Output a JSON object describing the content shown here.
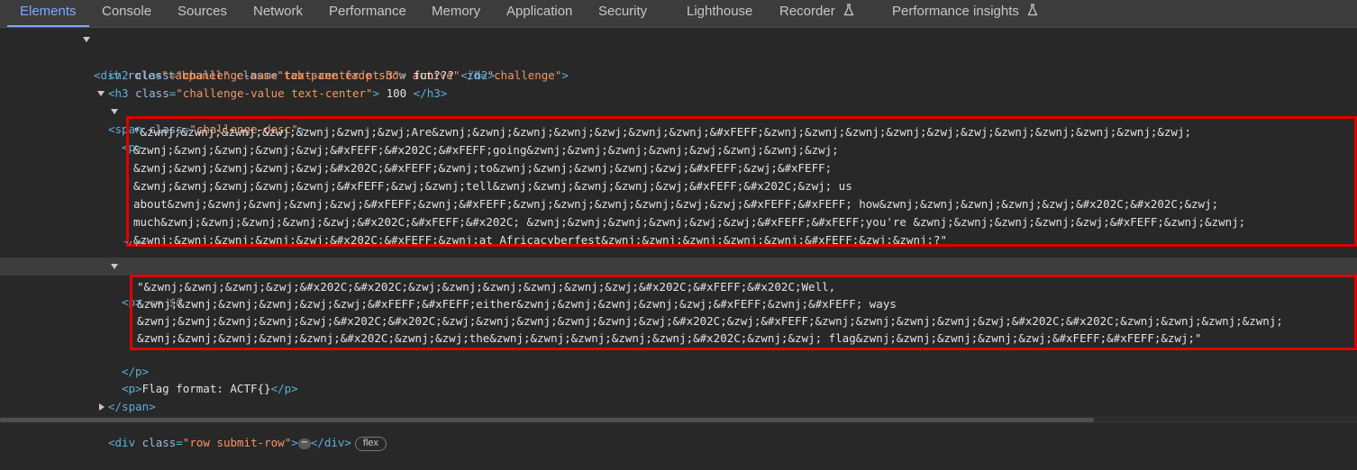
{
  "tabs": [
    {
      "label": "Elements"
    },
    {
      "label": "Console"
    },
    {
      "label": "Sources"
    },
    {
      "label": "Network"
    },
    {
      "label": "Performance"
    },
    {
      "label": "Memory"
    },
    {
      "label": "Application"
    },
    {
      "label": "Security"
    },
    {
      "label": "Lighthouse"
    },
    {
      "label": "Recorder"
    },
    {
      "label": "Performance insights"
    }
  ],
  "tree": {
    "div_open_tag": "div",
    "div_role_name": "role",
    "div_role_val": "\"tabpanel\"",
    "div_class_name": "class",
    "div_class_val": "\"tab-pane fade show active\"",
    "div_id_name": "id",
    "div_id_val": "\"challenge\"",
    "h2_class_val": "\"challenge-name text-center pt-3\"",
    "h2_text": " fun??? ",
    "h3_class_val": "\"challenge-value text-center\"",
    "h3_text": " 100 ",
    "span_class_val": "\"challenge-desc\"",
    "p1_lines": [
      "\"&zwnj;&zwnj;&zwnj;&zwj;&zwnj;&zwnj;&zwj;Are&zwnj;&zwnj;&zwnj;&zwnj;&zwj;&zwnj;&zwnj;&#xFEFF;&zwnj;&zwnj;&zwnj;&zwnj;&zwj;&zwj;&zwnj;&zwnj;&zwnj;&zwnj;&zwj;",
      "&zwnj;&zwnj;&zwnj;&zwnj;&zwj;&#xFEFF;&#x202C;&#xFEFF;going&zwnj;&zwnj;&zwnj;&zwnj;&zwj;&zwnj;&zwnj;&zwj;",
      "&zwnj;&zwnj;&zwnj;&zwnj;&zwj;&#x202C;&#xFEFF;&zwnj;to&zwnj;&zwnj;&zwnj;&zwnj;&zwj;&#xFEFF;&zwj;&#xFEFF;",
      "&zwnj;&zwnj;&zwnj;&zwnj;&zwnj;&#xFEFF;&zwj;&zwnj;tell&zwnj;&zwnj;&zwnj;&zwnj;&zwj;&#xFEFF;&#x202C;&zwj; us",
      "about&zwnj;&zwnj;&zwnj;&zwnj;&zwj;&#xFEFF;&zwnj;&#xFEFF;&zwnj;&zwnj;&zwnj;&zwnj;&zwj;&zwj;&#xFEFF;&#xFEFF; how&zwnj;&zwnj;&zwnj;&zwnj;&zwj;&#x202C;&#x202C;&zwj;",
      "much&zwnj;&zwnj;&zwnj;&zwnj;&zwj;&#x202C;&#xFEFF;&#x202C; &zwnj;&zwnj;&zwnj;&zwnj;&zwj;&zwj;&#xFEFF;&#xFEFF;you're &zwnj;&zwnj;&zwnj;&zwnj;&zwj;&#xFEFF;&zwnj;&zwnj;",
      "&zwnj;&zwnj;&zwnj;&zwnj;&zwj;&#x202C;&#xFEFF;&zwnj;at Africacyberfest&zwnj;&zwnj;&zwnj;&zwnj;&zwnj;&#xFEFF;&zwj;&zwnj;?\""
    ],
    "p2_selected_marker": "== $0",
    "p2_lines": [
      "\"&zwnj;&zwnj;&zwnj;&zwj;&#x202C;&#x202C;&zwj;&zwnj;&zwnj;&zwnj;&zwnj;&zwj;&#x202C;&#xFEFF;&#x202C;Well,",
      "&zwnj;&zwnj;&zwnj;&zwnj;&zwj;&zwj;&#xFEFF;&#xFEFF;either&zwnj;&zwnj;&zwnj;&zwnj;&zwj;&#xFEFF;&zwnj;&#xFEFF; ways",
      "&zwnj;&zwnj;&zwnj;&zwnj;&zwj;&#x202C;&#x202C;&zwj;&zwnj;&zwnj;&zwnj;&zwnj;&zwj;&#x202C;&zwj;&#xFEFF;&zwnj;&zwnj;&zwnj;&zwnj;&zwj;&#x202C;&#x202C;&zwnj;&zwnj;&zwnj;&zwnj;",
      "&zwnj;&zwnj;&zwnj;&zwnj;&zwnj;&#x202C;&zwnj;&zwj;the&zwnj;&zwnj;&zwnj;&zwnj;&zwnj;&#x202C;&zwnj;&zwj; flag&zwnj;&zwnj;&zwnj;&zwnj;&zwj;&#xFEFF;&#xFEFF;&zwj;\""
    ],
    "p3_text": "Flag format: ACTF{}",
    "div2_class_val": "\"row submit-row\"",
    "ellipsis": "⋯",
    "flex_badge": "flex"
  }
}
